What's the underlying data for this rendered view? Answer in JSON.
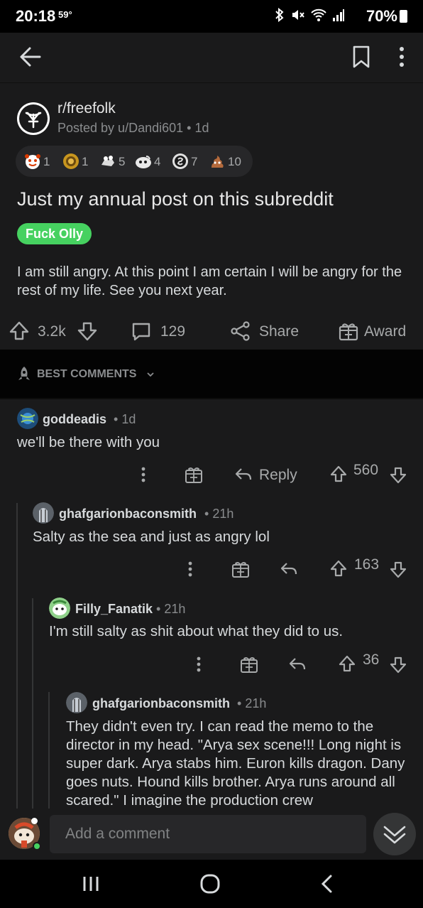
{
  "status": {
    "time": "20:18",
    "temp": "59°",
    "battery": "70%"
  },
  "post": {
    "subreddit": "r/freefolk",
    "posted_by": "Posted by u/Dandi601",
    "age": "1d",
    "awards": [
      {
        "icon": "wholesome-award-icon",
        "count": "1"
      },
      {
        "icon": "gold-coin-award-icon",
        "count": "1"
      },
      {
        "icon": "hugz-award-icon",
        "count": "5"
      },
      {
        "icon": "helpful-award-icon",
        "count": "4"
      },
      {
        "icon": "silver-award-icon",
        "count": "7"
      },
      {
        "icon": "poop-award-icon",
        "count": "10"
      }
    ],
    "title": "Just my annual post on this subreddit",
    "flair": "Fuck Olly",
    "body": "I am still angry. At this point I am certain I will be angry for the rest of my life. See you next year.",
    "votes": "3.2k",
    "comments_count": "129",
    "share_label": "Share",
    "award_label": "Award"
  },
  "sort": {
    "label": "BEST COMMENTS"
  },
  "comments": [
    {
      "author": "goddeadis",
      "time": "1d",
      "text": "we'll be there with you",
      "reply_label": "Reply",
      "votes": "560"
    },
    {
      "author": "ghafgarionbaconsmith",
      "time": "21h",
      "text": "Salty as the sea and just as angry lol",
      "votes": "163"
    },
    {
      "author": "Filly_Fanatik",
      "time": "21h",
      "text": "I'm still salty as shit about what they did to us.",
      "votes": "36"
    },
    {
      "author": "ghafgarionbaconsmith",
      "time": "21h",
      "text": "They didn't even try. I can read the memo to the director in my head. \"Arya sex scene!!! Long night is super dark. Arya stabs him. Euron kills dragon. Dany goes nuts. Hound kills brother. Arya runs around all scared.\" I imagine the production crew"
    }
  ],
  "composer": {
    "placeholder": "Add a comment"
  },
  "colors": {
    "background": "#1a1a1b",
    "flair": "#46d160",
    "page": "#000000"
  }
}
